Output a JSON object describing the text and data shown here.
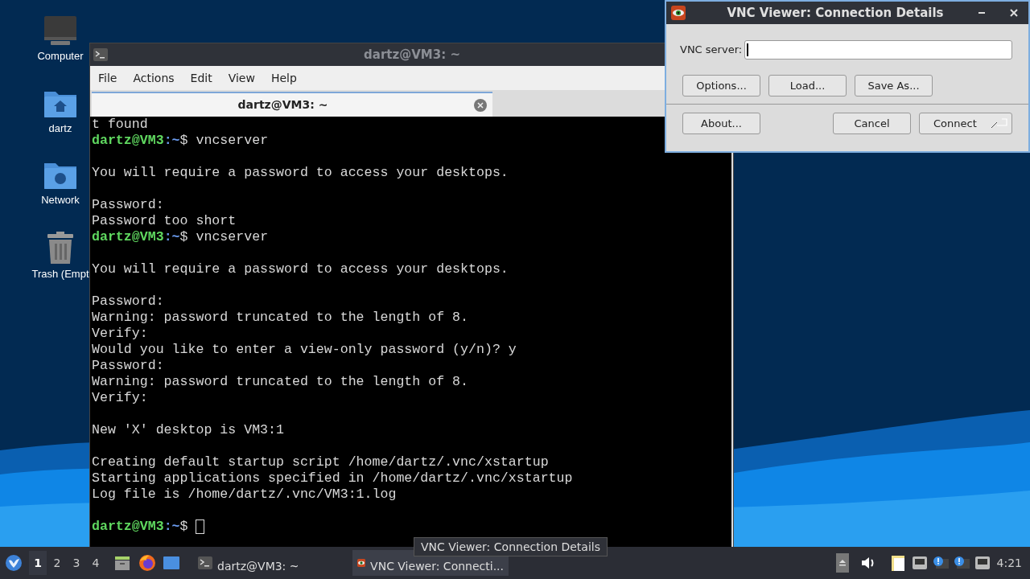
{
  "desktop_icons": [
    {
      "kind": "computer",
      "label": "Computer"
    },
    {
      "kind": "home",
      "label": "dartz"
    },
    {
      "kind": "network",
      "label": "Network"
    },
    {
      "kind": "trash",
      "label": "Trash (Empt"
    }
  ],
  "terminal": {
    "title": "dartz@VM3: ~",
    "menu": [
      "File",
      "Actions",
      "Edit",
      "View",
      "Help"
    ],
    "tab": {
      "title": "dartz@VM3: ~",
      "selected": true
    },
    "lines": [
      {
        "kind": "text",
        "text": "t found"
      },
      {
        "kind": "prompt",
        "user": "dartz@VM3",
        "path": ":~",
        "command": "$ vncserver"
      },
      {
        "kind": "blank"
      },
      {
        "kind": "text",
        "text": "You will require a password to access your desktops."
      },
      {
        "kind": "blank"
      },
      {
        "kind": "text",
        "text": "Password:"
      },
      {
        "kind": "text",
        "text": "Password too short"
      },
      {
        "kind": "prompt",
        "user": "dartz@VM3",
        "path": ":~",
        "command": "$ vncserver"
      },
      {
        "kind": "blank"
      },
      {
        "kind": "text",
        "text": "You will require a password to access your desktops."
      },
      {
        "kind": "blank"
      },
      {
        "kind": "text",
        "text": "Password:"
      },
      {
        "kind": "text",
        "text": "Warning: password truncated to the length of 8."
      },
      {
        "kind": "text",
        "text": "Verify:"
      },
      {
        "kind": "text",
        "text": "Would you like to enter a view-only password (y/n)? y"
      },
      {
        "kind": "text",
        "text": "Password:"
      },
      {
        "kind": "text",
        "text": "Warning: password truncated to the length of 8."
      },
      {
        "kind": "text",
        "text": "Verify:"
      },
      {
        "kind": "blank"
      },
      {
        "kind": "text",
        "text": "New 'X' desktop is VM3:1"
      },
      {
        "kind": "blank"
      },
      {
        "kind": "text",
        "text": "Creating default startup script /home/dartz/.vnc/xstartup"
      },
      {
        "kind": "text",
        "text": "Starting applications specified in /home/dartz/.vnc/xstartup"
      },
      {
        "kind": "text",
        "text": "Log file is /home/dartz/.vnc/VM3:1.log"
      },
      {
        "kind": "blank"
      },
      {
        "kind": "prompt",
        "user": "dartz@VM3",
        "path": ":~",
        "command": "$ ",
        "cursor": true
      }
    ]
  },
  "vnc_dialog": {
    "title": "VNC Viewer: Connection Details",
    "server_label": "VNC server:",
    "top_buttons": [
      "Options...",
      "Load...",
      "Save As..."
    ],
    "about": "About...",
    "cancel": "Cancel",
    "connect": "Connect"
  },
  "taskbar": {
    "workspaces": [
      {
        "label": "1",
        "selected": true
      },
      {
        "label": "2",
        "selected": false
      },
      {
        "label": "3",
        "selected": false
      },
      {
        "label": "4",
        "selected": false
      }
    ],
    "tasks": [
      {
        "kind": "terminal",
        "label": "dartz@VM3: ~",
        "selected": false
      },
      {
        "kind": "vnc",
        "label": "VNC Viewer: Connecti...",
        "selected": true
      }
    ],
    "tooltip": "VNC Viewer: Connection Details",
    "clock": "4:21"
  }
}
